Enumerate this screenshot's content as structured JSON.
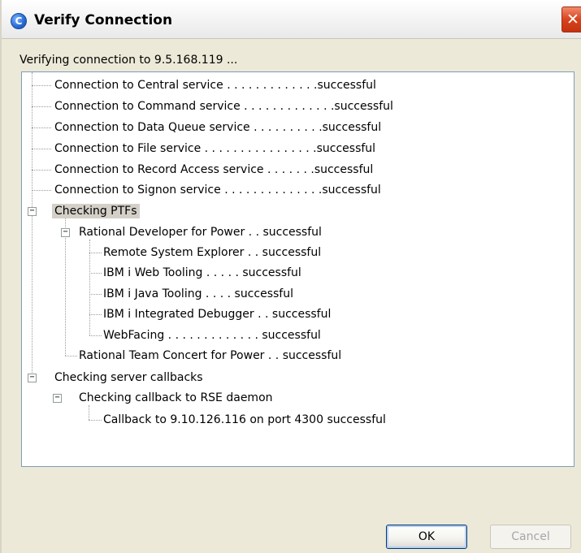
{
  "window": {
    "title": "Verify Connection",
    "icon_glyph": "C",
    "close_glyph": "✕"
  },
  "status": {
    "verifying_text": "Verifying connection to 9.5.168.119 ..."
  },
  "tree": {
    "connections": [
      "Connection to Central service . . . . . . . . . . . . .successful",
      "Connection to Command service . . . . . . . . . . . . .successful",
      "Connection to Data Queue service . . . . . . . . . .successful",
      "Connection to File service . . . . . . . . . . . . . . . .successful",
      "Connection to Record Access service . . . . . . .successful",
      "Connection to Signon service . . . . . . . . . . . . . .successful"
    ],
    "ptfs_label": "Checking PTFs",
    "rdp_label": "Rational Developer for Power . . successful",
    "rdp_children": [
      "Remote System Explorer . . successful",
      "IBM i Web Tooling . . . . . successful",
      "IBM i Java Tooling . . . . successful",
      "IBM i Integrated Debugger . . successful",
      "WebFacing . . . . . . . . . . . . . successful"
    ],
    "rtc_label": "Rational Team Concert for Power . . successful",
    "callbacks_label": "Checking server callbacks",
    "rse_label": "Checking callback to RSE daemon",
    "callback_result": "Callback to 9.10.126.116 on port 4300 successful",
    "expander_glyph": "−"
  },
  "buttons": {
    "ok_label": "OK",
    "cancel_label": "Cancel"
  },
  "colors": {
    "window_bg": "#ece9d8",
    "panel_border": "#7f9db9",
    "close_red": "#d9431f",
    "selected_bg": "#d4d0c8"
  }
}
